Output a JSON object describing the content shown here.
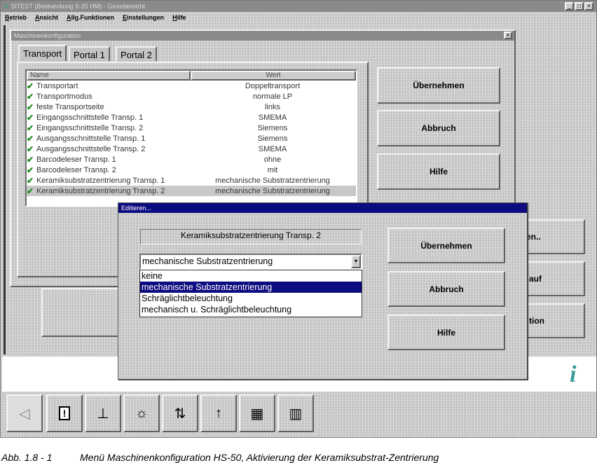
{
  "app": {
    "title": "SITEST (Bestueckung S-25 HM) - Grundansicht",
    "window_controls": [
      "_",
      "□",
      "×"
    ],
    "menu": [
      "Betrieb",
      "Ansicht",
      "Allg.Funktionen",
      "Einstellungen",
      "Hilfe"
    ]
  },
  "config_dialog": {
    "title": "Maschinenkonfiguration",
    "close": "×",
    "tabs": [
      "Transport",
      "Portal 1",
      "Portal 2"
    ],
    "columns": [
      "Name",
      "Wert"
    ],
    "rows": [
      {
        "name": "Transportart",
        "value": "Doppeltransport"
      },
      {
        "name": "Transportmodus",
        "value": "normale LP"
      },
      {
        "name": "feste Transportseite",
        "value": "links"
      },
      {
        "name": "Eingangsschnittstelle Transp. 1",
        "value": "SMEMA"
      },
      {
        "name": "Eingangsschnittstelle Transp. 2",
        "value": "Siemens"
      },
      {
        "name": "Ausgangsschnittstelle Transp. 1",
        "value": "Siemens"
      },
      {
        "name": "Ausgangsschnittstelle Transp. 2",
        "value": "SMEMA"
      },
      {
        "name": "Barcodeleser Transp. 1",
        "value": "ohne"
      },
      {
        "name": "Barcodeleser Transp. 2",
        "value": "mit"
      },
      {
        "name": "Keramiksubstratzentrierung Transp. 1",
        "value": "mechanische Substratzentrierung"
      },
      {
        "name": "Keramiksubstratzentrierung Transp. 2",
        "value": "mechanische Substratzentrierung"
      }
    ],
    "buttons": [
      "Übernehmen",
      "Abbruch",
      "Hilfe"
    ]
  },
  "background_buttons": [
    "en..",
    "auf",
    "tion"
  ],
  "edit_dialog": {
    "title": "Editieren...",
    "label": "Keramiksubstratzentrierung Transp. 2",
    "combo_value": "mechanische Substratzentrierung",
    "options": [
      "keine",
      "mechanische Substratzentrierung",
      "Schräglichtbeleuchtung",
      "mechanisch u. Schräglichtbeleuchtung"
    ],
    "selected_index": 1,
    "buttons": [
      "Übernehmen",
      "Abbruch",
      "Hilfe"
    ]
  },
  "toolbar": {
    "icons": [
      "◁",
      "!",
      "⊥",
      "☼",
      "⇅",
      "↑",
      "▦",
      "▥"
    ]
  },
  "info_icon": "i",
  "caption": {
    "number": "Abb. 1.8 - 1",
    "text": "Menü Maschinenkonfiguration HS-50, Aktivierung der Keramiksubstrat-Zentrierung"
  }
}
